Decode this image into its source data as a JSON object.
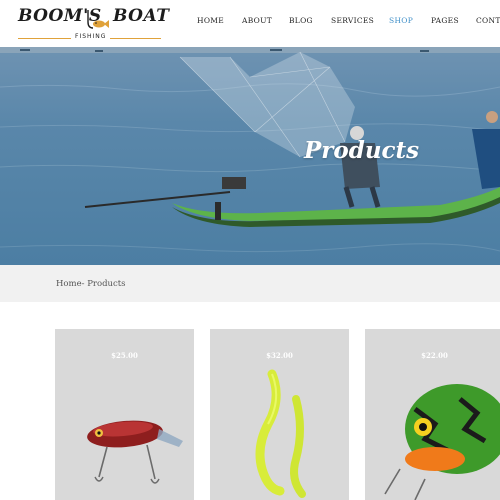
{
  "brand": {
    "left_word": "BOOM'S",
    "right_word": "BOAT",
    "tagline": "FISHING",
    "accent_color": "#e0a23a"
  },
  "nav": {
    "items": [
      {
        "label": "HOME"
      },
      {
        "label": "ABOUT"
      },
      {
        "label": "BLOG"
      },
      {
        "label": "SERVICES"
      },
      {
        "label": "SHOP",
        "active": true
      },
      {
        "label": "PAGES"
      },
      {
        "label": "CONT"
      }
    ],
    "active_color": "#3f8fc8"
  },
  "hero": {
    "title": "Products"
  },
  "breadcrumb": {
    "text": "Home- Products"
  },
  "products": [
    {
      "price": "$25.00",
      "icon": "red-crankbait-lure-image"
    },
    {
      "price": "$32.00",
      "icon": "green-soft-worm-lure-image"
    },
    {
      "price": "$22.00",
      "icon": "green-crankbait-lure-image"
    }
  ]
}
